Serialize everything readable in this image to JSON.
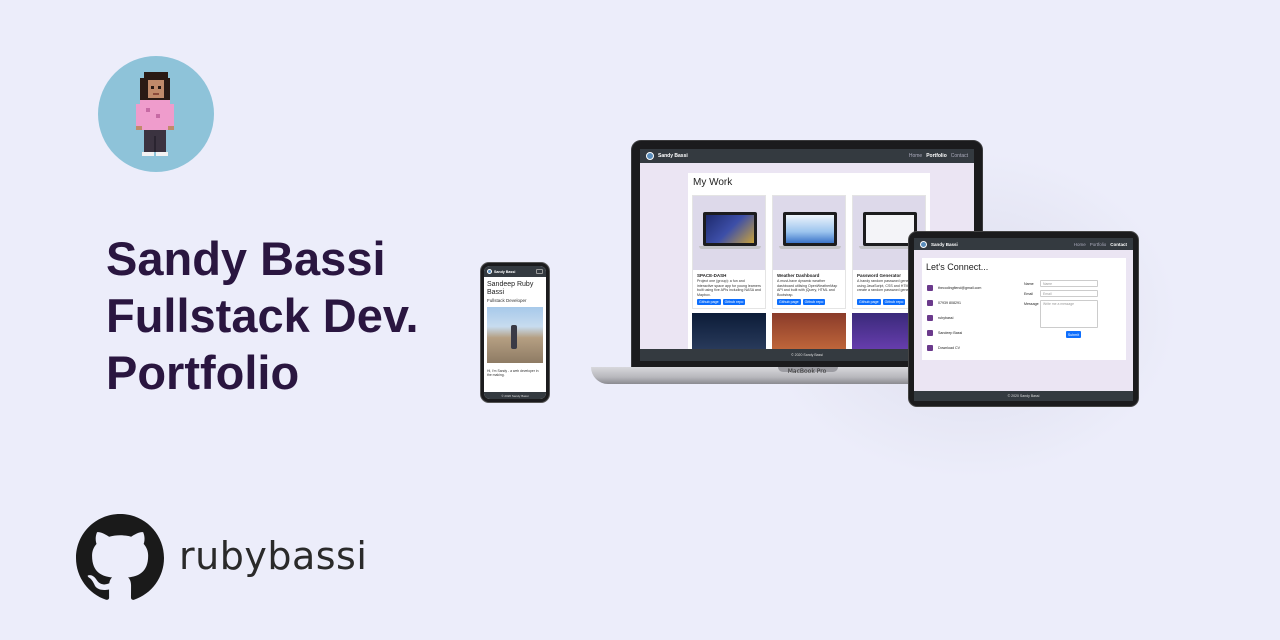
{
  "hero": {
    "line1": "Sandy Bassi",
    "line2": "Fullstack Dev.",
    "line3": "Portfolio"
  },
  "github": {
    "username": "rubybassi",
    "icon": "github-icon"
  },
  "colors": {
    "background": "#ecedfa",
    "title": "#2a1640",
    "navbar": "#343a40",
    "button": "#0d6efd",
    "avatar_bg": "#8ec3d9"
  },
  "laptop": {
    "device_label": "MacBook Pro",
    "nav": {
      "brand": "Sandy Bassi",
      "links": [
        "Home",
        "Portfolio",
        "Contact"
      ]
    },
    "section_title": "My Work",
    "cards": [
      {
        "title": "SPACE-DASH",
        "text": "Project one (group): a fun and interactive space app for young learners built using five APIs including NASA and Mapbox.",
        "btn1": "Github page",
        "btn2": "Github repo"
      },
      {
        "title": "Weather Dashboard",
        "text": "A must-have dynamic weather dashboard utilising OpenWeatherMap API and built with jQuery, HTML and Bootstrap.",
        "btn1": "Github page",
        "btn2": "Github repo"
      },
      {
        "title": "Password Generator",
        "text": "A handy random password generator using JavaScript, CSS and HTML to create a random password generator.",
        "btn1": "Github page",
        "btn2": "Github repo"
      }
    ],
    "footer": "© 2020 Sandy Bassi"
  },
  "tablet": {
    "nav": {
      "brand": "Sandy Bassi",
      "links": [
        "Home",
        "Portfolio",
        "Contact"
      ]
    },
    "section_title": "Let's Connect...",
    "contact_items": [
      "thecodingfiend@gmail.com",
      "07939 808291",
      "rubybassi",
      "Sandeep Bassi",
      "Download CV"
    ],
    "form": {
      "name_label": "Name",
      "name_placeholder": "Name",
      "email_label": "Email",
      "email_placeholder": "Email",
      "message_label": "Message",
      "message_placeholder": "Write me a message",
      "submit": "Submit"
    },
    "footer": "© 2020 Sandy Bassi"
  },
  "phone": {
    "nav_brand": "Sandy Bassi",
    "name": "Sandeep Ruby Bassi",
    "role": "Fullstack Developer",
    "bio": "Hi, I'm Sandy - a web developer in the making.",
    "footer": "© 2020 Sandy Bassi"
  }
}
